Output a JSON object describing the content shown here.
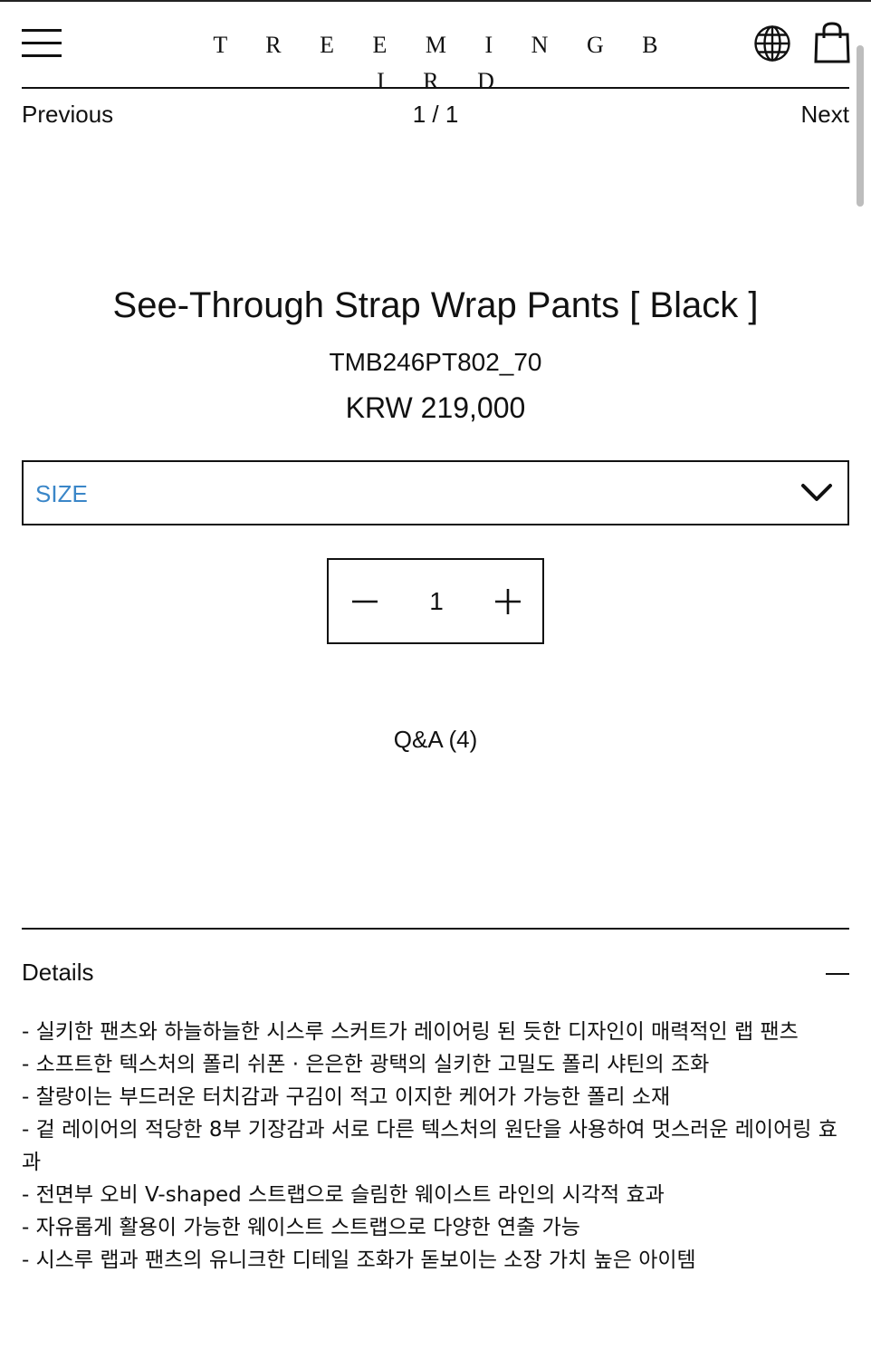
{
  "header": {
    "brand": "T R E E M I N G B I R D",
    "menu_icon": "hamburger-menu-icon",
    "globe_icon": "globe-icon",
    "bag_icon": "shopping-bag-icon"
  },
  "pager": {
    "previous": "Previous",
    "count": "1 / 1",
    "next": "Next"
  },
  "product": {
    "title": "See-Through Strap Wrap Pants [ Black ]",
    "code": "TMB246PT802_70",
    "price": "KRW 219,000"
  },
  "size_select": {
    "label": "SIZE",
    "label_color": "#3a86c8"
  },
  "quantity": {
    "minus_icon": "minus-icon",
    "value": "1",
    "plus_icon": "plus-icon"
  },
  "qna": {
    "label": "Q&A (4)"
  },
  "details": {
    "label": "Details",
    "collapse_icon": "collapse-minus-icon",
    "items": [
      "- 실키한 팬츠와 하늘하늘한 시스루 스커트가 레이어링 된 듯한 디자인이 매력적인 랩 팬츠",
      "- 소프트한 텍스처의 폴리 쉬폰 · 은은한 광택의 실키한 고밀도 폴리 샤틴의 조화",
      "- 찰랑이는 부드러운 터치감과 구김이 적고 이지한 케어가 가능한 폴리 소재",
      "- 겉 레이어의 적당한 8부 기장감과 서로 다른 텍스처의 원단을 사용하여 멋스러운 레이어링 효과",
      "- 전면부 오비 V-shaped 스트랩으로 슬림한 웨이스트 라인의 시각적 효과",
      "- 자유롭게 활용이 가능한 웨이스트 스트랩으로 다양한 연출 가능",
      "- 시스루 랩과 팬츠의 유니크한 디테일 조화가 돋보이는 소장 가치 높은 아이템"
    ]
  }
}
